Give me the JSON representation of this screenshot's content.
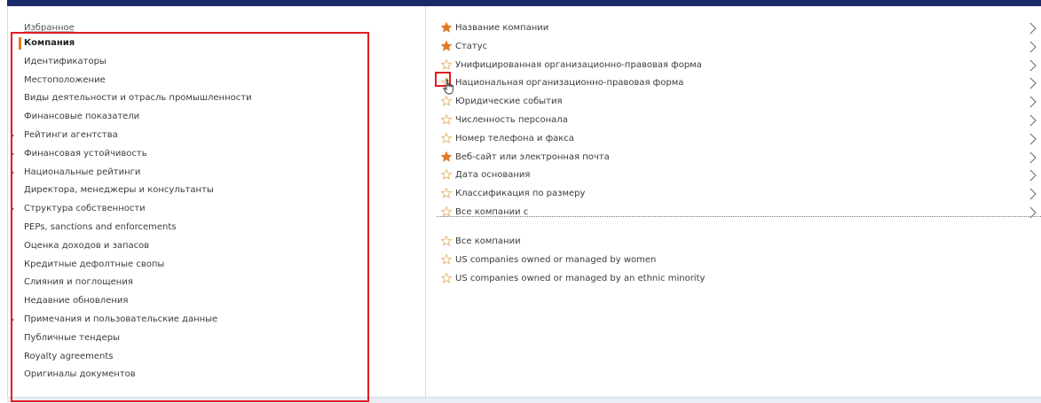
{
  "left_menu": {
    "favorites": "Избранное",
    "items": [
      {
        "label": "Компания",
        "active": true,
        "expandable": false
      },
      {
        "label": "Идентификаторы",
        "active": false,
        "expandable": false
      },
      {
        "label": "Местоположение",
        "active": false,
        "expandable": false
      },
      {
        "label": "Виды деятельности и отрасль промышленности",
        "active": false,
        "expandable": false
      },
      {
        "label": "Финансовые показатели",
        "active": false,
        "expandable": false
      },
      {
        "label": "Рейтинги агентства",
        "active": false,
        "expandable": true
      },
      {
        "label": "Финансовая устойчивость",
        "active": false,
        "expandable": true
      },
      {
        "label": "Национальные рейтинги",
        "active": false,
        "expandable": true
      },
      {
        "label": "Директора, менеджеры и консультанты",
        "active": false,
        "expandable": false
      },
      {
        "label": "Структура собственности",
        "active": false,
        "expandable": true
      },
      {
        "label": "PEPs, sanctions and enforcements",
        "active": false,
        "expandable": false
      },
      {
        "label": "Оценка доходов и запасов",
        "active": false,
        "expandable": false
      },
      {
        "label": "Кредитные дефолтные свопы",
        "active": false,
        "expandable": false
      },
      {
        "label": "Слияния и поглощения",
        "active": false,
        "expandable": false
      },
      {
        "label": "Недавние обновления",
        "active": false,
        "expandable": false
      },
      {
        "label": "Примечания и пользовательские данные",
        "active": false,
        "expandable": true
      },
      {
        "label": "Публичные тендеры",
        "active": false,
        "expandable": false
      },
      {
        "label": "Royalty agreements",
        "active": false,
        "expandable": false
      },
      {
        "label": "Оригиналы документов",
        "active": false,
        "expandable": false
      }
    ]
  },
  "fields": [
    {
      "label": "Название компании",
      "starred": true
    },
    {
      "label": "Статус",
      "starred": true
    },
    {
      "label": "Унифицированная организационно-правовая форма",
      "starred": false
    },
    {
      "label": "Национальная организационно-правовая форма",
      "starred": false,
      "highlighted": true
    },
    {
      "label": "Юридические события",
      "starred": false
    },
    {
      "label": "Численность персонала",
      "starred": false
    },
    {
      "label": "Номер телефона и факса",
      "starred": false
    },
    {
      "label": "Веб-сайт или электронная почта",
      "starred": true
    },
    {
      "label": "Дата основания",
      "starred": false
    },
    {
      "label": "Классификация по размеру",
      "starred": false
    },
    {
      "label": "Все компании с",
      "starred": false
    }
  ],
  "sets": [
    {
      "label": "Все компании",
      "starred": false
    },
    {
      "label": "US companies owned or managed by women",
      "starred": false
    },
    {
      "label": "US companies owned or managed by an ethnic minority",
      "starred": false
    }
  ],
  "colors": {
    "star_filled": "#e07b24",
    "star_outline": "#e8b169",
    "highlight": "#e21b23",
    "active_marker": "#e07b24",
    "top_bar": "#1b2a6b"
  },
  "icons": {
    "filled_star": "star-filled-icon",
    "outline_star": "star-outline-icon",
    "chevron": "chevron-right-icon",
    "expand": "caret-right-icon",
    "pointer": "hand-cursor-icon"
  }
}
